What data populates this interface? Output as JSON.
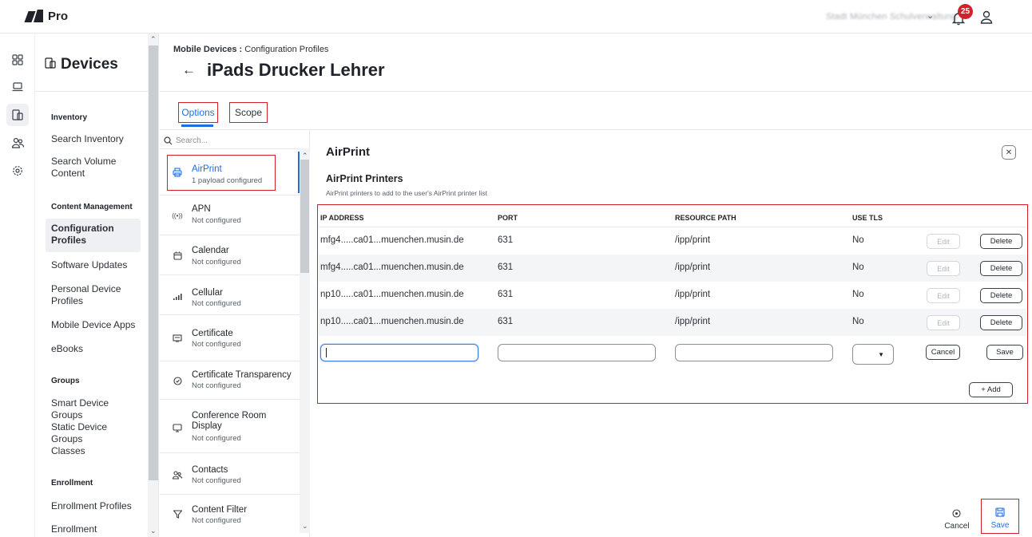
{
  "app": {
    "brand": "Pro",
    "org_name": "Stadt München Schulverwaltung",
    "notification_count": "25"
  },
  "rail": {
    "icons": [
      "dashboard-icon",
      "computers-icon",
      "devices-icon",
      "users-icon",
      "settings-icon"
    ]
  },
  "leftnav": {
    "title": "Devices",
    "sections": [
      {
        "heading": "Inventory",
        "items": [
          "Search Inventory",
          "Search Volume Content"
        ]
      },
      {
        "heading": "Content Management",
        "items": [
          "Configuration Profiles",
          "Software Updates",
          "Personal Device Profiles",
          "Mobile Device Apps",
          "eBooks"
        ]
      },
      {
        "heading": "Groups",
        "items": [
          "Smart Device Groups",
          "Static Device Groups",
          "Classes"
        ]
      },
      {
        "heading": "Enrollment",
        "items": [
          "Enrollment Profiles",
          "Enrollment Invitations"
        ]
      }
    ]
  },
  "breadcrumb": {
    "parent": "Mobile Devices :",
    "current": "Configuration Profiles"
  },
  "page_title": "iPads Drucker Lehrer",
  "tabs": [
    "Options",
    "Scope"
  ],
  "search": {
    "placeholder": "Search..."
  },
  "payloads": [
    {
      "name": "AirPrint",
      "status": "1 payload configured",
      "icon": "printer-icon"
    },
    {
      "name": "APN",
      "status": "Not configured",
      "icon": "antenna-icon"
    },
    {
      "name": "Calendar",
      "status": "Not configured",
      "icon": "calendar-icon"
    },
    {
      "name": "Cellular",
      "status": "Not configured",
      "icon": "signal-icon"
    },
    {
      "name": "Certificate",
      "status": "Not configured",
      "icon": "certificate-icon"
    },
    {
      "name": "Certificate Transparency",
      "status": "Not configured",
      "icon": "check-circle-icon"
    },
    {
      "name": "Conference Room Display",
      "status": "Not configured",
      "icon": "display-icon"
    },
    {
      "name": "Contacts",
      "status": "Not configured",
      "icon": "contacts-icon"
    },
    {
      "name": "Content Filter",
      "status": "Not configured",
      "icon": "filter-icon"
    }
  ],
  "airprint": {
    "title": "AirPrint",
    "subtitle": "AirPrint Printers",
    "description": "AirPrint printers to add to the user's AirPrint printer list",
    "columns": [
      "IP ADDRESS",
      "PORT",
      "RESOURCE PATH",
      "USE TLS"
    ],
    "rows": [
      {
        "ip": "mfg4.....ca01...muenchen.musin.de",
        "port": "631",
        "path": "/ipp/print",
        "tls": "No"
      },
      {
        "ip": "mfg4.....ca01...muenchen.musin.de",
        "port": "631",
        "path": "/ipp/print",
        "tls": "No"
      },
      {
        "ip": "np10.....ca01...muenchen.musin.de",
        "port": "631",
        "path": "/ipp/print",
        "tls": "No"
      },
      {
        "ip": "np10.....ca01...muenchen.musin.de",
        "port": "631",
        "path": "/ipp/print",
        "tls": "No"
      }
    ],
    "edit_label": "Edit",
    "delete_label": "Delete",
    "cancel_label": "Cancel",
    "save_label": "Save",
    "add_label": "+ Add"
  },
  "footer": {
    "cancel": "Cancel",
    "save": "Save"
  }
}
